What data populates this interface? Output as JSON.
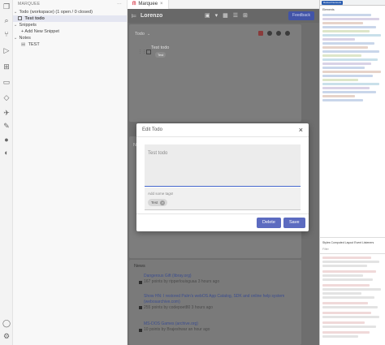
{
  "sidebar": {
    "header": "MARQUEE",
    "todo_section": "Todo (workspace) (1 open / 0 closed)",
    "todo_item": "Test todo",
    "snippets_section": "Snippets",
    "add_snippet": "+ Add New Snippet",
    "notes_section": "Notes",
    "note_item": "TEST"
  },
  "tab": {
    "label": "Marquee"
  },
  "appbar": {
    "workspace": "Lorenzo",
    "feedback": "Feedback"
  },
  "todo_card": {
    "title": "Todo",
    "item_text": "Test todo",
    "item_tag": "Test"
  },
  "news": {
    "title": "News",
    "items": [
      {
        "title": "Dangerous Gift (libray.org)",
        "meta": "167 points by ripperlouisguaa  3 hours ago"
      },
      {
        "title": "Show HN: I restored Palm's webOS App Catalog, SDK and online help system (webosarchive.com)",
        "meta": "255 points by codepoet80  3 hours ago"
      },
      {
        "title": "MS-DOS Games (archive.org)",
        "meta": "10 points by Brajeshwar  an hour ago"
      }
    ]
  },
  "modal": {
    "title": "Edit Todo",
    "text_value": "Test todo",
    "tags_placeholder": "Add some tags!",
    "chip": "Test",
    "delete_label": "Delete",
    "save_label": "Save"
  },
  "devtools": {
    "reload": "Reload Devtools",
    "tabs": "Elements",
    "styles_tab": "Styles  Computed  Layout  Event Listeners",
    "filter": "Filter"
  },
  "colors": {
    "accent": "#5c6bc0",
    "appbar": "#686868",
    "overlay": "#6e6e6e"
  }
}
